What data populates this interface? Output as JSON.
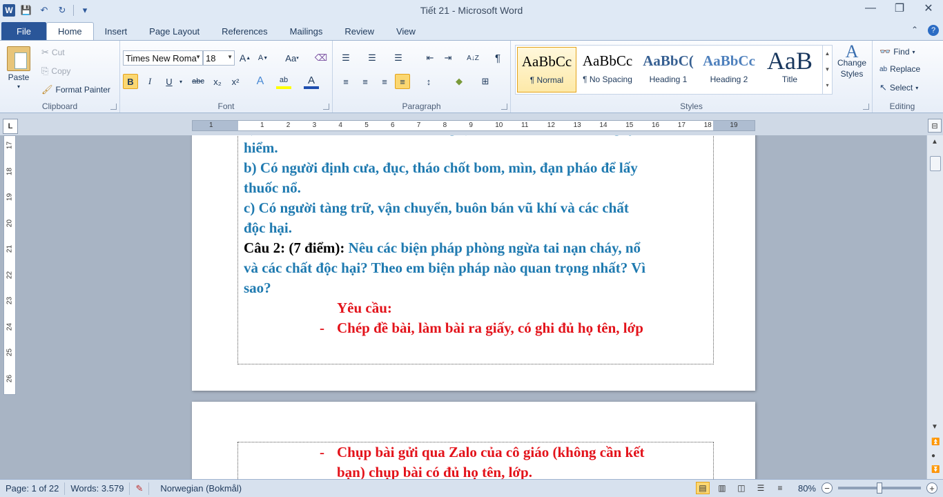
{
  "window": {
    "title": "Tiết 21 - Microsoft Word",
    "minimize": "—",
    "restore": "❐",
    "close": "✕"
  },
  "qat": {
    "word_logo": "W",
    "save": "💾",
    "undo": "↶",
    "redo": "↻",
    "customize": "▾"
  },
  "tabs": [
    {
      "label": "File"
    },
    {
      "label": "Home"
    },
    {
      "label": "Insert"
    },
    {
      "label": "Page Layout"
    },
    {
      "label": "References"
    },
    {
      "label": "Mailings"
    },
    {
      "label": "Review"
    },
    {
      "label": "View"
    }
  ],
  "tabs_right": {
    "minimize_ribbon": "⌃",
    "help": "?"
  },
  "clipboard": {
    "paste": "Paste",
    "cut": "Cut",
    "copy": "Copy",
    "format_painter": "Format Painter",
    "label": "Clipboard"
  },
  "font": {
    "name": "Times New Roma",
    "size": "18",
    "grow": "A",
    "shrink": "A",
    "change_case": "Aa",
    "bold": "B",
    "italic": "I",
    "underline": "U",
    "strike": "abc",
    "subscript": "x₂",
    "superscript": "x²",
    "text_effects": "A",
    "highlight": "ab",
    "color": "A",
    "label": "Font"
  },
  "paragraph": {
    "bullets": "☰",
    "numbering": "☰",
    "multilevel": "☰",
    "decrease_indent": "⇤",
    "increase_indent": "⇥",
    "sort": "A↓Z",
    "show_marks": "¶",
    "align_left": "≡",
    "center": "≡",
    "align_right": "≡",
    "justify": "≡",
    "line_spacing": "↕",
    "shading": "◆",
    "borders": "⊞",
    "label": "Paragraph"
  },
  "styles": {
    "items": [
      {
        "sample": "AaBbCc",
        "name": "¶ Normal",
        "color": "#000000"
      },
      {
        "sample": "AaBbCc",
        "name": "¶ No Spacing",
        "color": "#000000"
      },
      {
        "sample": "AaBbC(",
        "name": "Heading 1",
        "color": "#376092"
      },
      {
        "sample": "AaBbCc",
        "name": "Heading 2",
        "color": "#4f81bd"
      },
      {
        "sample": "AaB",
        "name": "Title",
        "color": "#17365d"
      }
    ],
    "change_styles": "Change Styles",
    "label": "Styles"
  },
  "editing": {
    "find": "Find",
    "replace": "Replace",
    "select": "Select",
    "label": "Editing"
  },
  "ruler": {
    "corner": "L",
    "ticks": [
      "1",
      "1",
      "2",
      "3",
      "4",
      "5",
      "6",
      "7",
      "8",
      "9",
      "10",
      "11",
      "12",
      "13",
      "14",
      "15",
      "16",
      "17",
      "18",
      "19"
    ],
    "vticks": [
      "17",
      "18",
      "19",
      "20",
      "21",
      "22",
      "23",
      "24",
      "25",
      "26"
    ]
  },
  "document": {
    "page1_lines": [
      {
        "text": "a)  Đặt sẽ hoặc các em nhỏ chơi, nghịch các vật lạ, các chất nguy",
        "cls": ""
      },
      {
        "text": "hiểm.",
        "cls": ""
      },
      {
        "text": "b)  Có người định cưa, đục, tháo chốt bom, mìn, đạn pháo để lấy",
        "cls": ""
      },
      {
        "text": "thuốc nổ.",
        "cls": ""
      },
      {
        "text": "c)  Có người tàng trữ, vận chuyển, buôn bán vũ khí và các chất",
        "cls": ""
      },
      {
        "text": "độc hại.",
        "cls": ""
      }
    ],
    "q2_label": "Câu 2: (7 điểm):",
    "q2_text_1": " Nêu các biện pháp phòng ngừa tai nạn cháy, nổ",
    "q2_line_2": "và các chất độc hại? Theo em biện pháp nào quan trọng nhất? Vì",
    "q2_line_3": "sao?",
    "req_title": "Yêu cầu:",
    "req_dash": "-",
    "req_1": "Chép đề bài, làm bài ra giấy, có ghi đủ họ tên, lớp",
    "req_2_line1": "Chụp bài gửi qua Zalo của cô giáo (không cần kết",
    "req_2_line2": "bạn) chụp bài có đủ họ tên, lớp."
  },
  "status": {
    "page": "Page: 1 of 22",
    "words": "Words: 3.579",
    "proof_icon": "✎",
    "language": "Norwegian (Bokmål)",
    "zoom": "80%",
    "zoom_out": "−",
    "zoom_in": "+"
  }
}
